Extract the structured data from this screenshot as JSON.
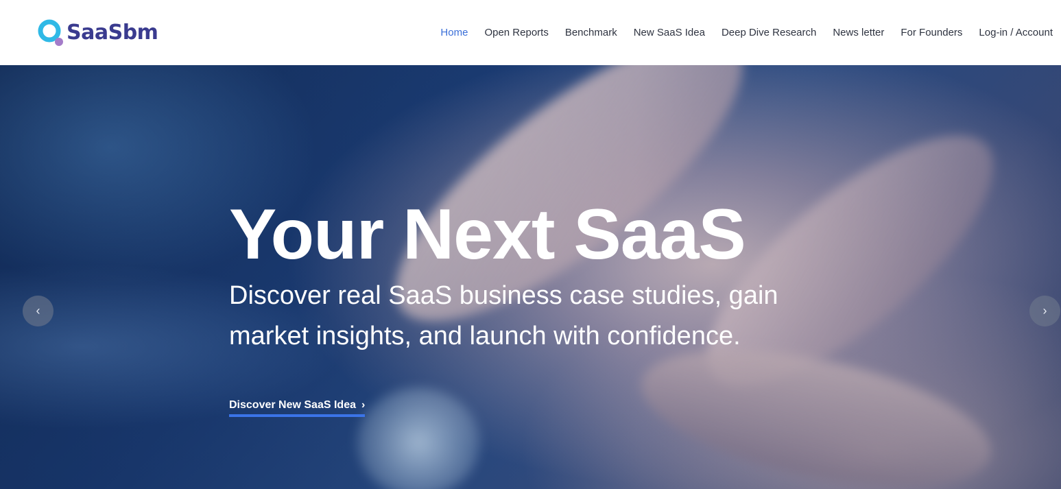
{
  "brand": {
    "name": "SaaSbm",
    "colors": {
      "logo_teal": "#2fb9e6",
      "logo_purple": "#a47cc9",
      "logo_text": "#3a3b8f"
    }
  },
  "nav": {
    "active_color": "#3b6fd8",
    "items": [
      {
        "label": "Home",
        "active": true
      },
      {
        "label": "Open Reports"
      },
      {
        "label": "Benchmark"
      },
      {
        "label": "New SaaS Idea"
      },
      {
        "label": "Deep Dive Research"
      },
      {
        "label": "News letter"
      },
      {
        "label": "For Founders"
      },
      {
        "label": "Log-in / Account"
      }
    ]
  },
  "hero": {
    "title": "Your Next SaaS",
    "subtitle": "Discover real SaaS business case studies, gain market insights, and launch with confidence.",
    "cta_label": "Discover New SaaS Idea",
    "cta_icon": "chevron-right-icon",
    "cta_underline_color": "#3b74e8",
    "prev_icon": "chevron-left-icon",
    "next_icon": "chevron-right-icon"
  }
}
